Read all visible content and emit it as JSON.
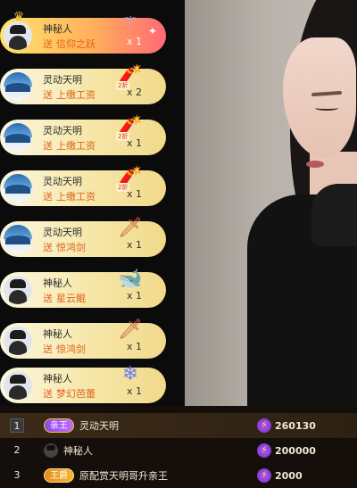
{
  "gift_feed": [
    {
      "user": "神秘人",
      "verb": "送",
      "gift": "信仰之跃",
      "count": "x 1",
      "avatar": "mystery",
      "icon": "staff-icon",
      "crown": true,
      "special": true
    },
    {
      "user": "灵动天明",
      "verb": "送",
      "gift": "上缴工资",
      "count": "x 2",
      "avatar": "landscape",
      "icon": "firecracker-icon",
      "discount": "2折"
    },
    {
      "user": "灵动天明",
      "verb": "送",
      "gift": "上缴工资",
      "count": "x 1",
      "avatar": "landscape",
      "icon": "firecracker-icon",
      "discount": "2折"
    },
    {
      "user": "灵动天明",
      "verb": "送",
      "gift": "上缴工资",
      "count": "x 1",
      "avatar": "landscape",
      "icon": "firecracker-icon",
      "discount": "2折"
    },
    {
      "user": "灵动天明",
      "verb": "送",
      "gift": "惊鸿剑",
      "count": "x 1",
      "avatar": "landscape",
      "icon": "sword-icon"
    },
    {
      "user": "神秘人",
      "verb": "送",
      "gift": "星云鲲",
      "count": "x 1",
      "avatar": "mystery",
      "icon": "fish-icon"
    },
    {
      "user": "神秘人",
      "verb": "送",
      "gift": "惊鸿剑",
      "count": "x 1",
      "avatar": "mystery",
      "icon": "sword-icon"
    },
    {
      "user": "神秘人",
      "verb": "送",
      "gift": "梦幻芭蕾",
      "count": "x 1",
      "avatar": "mystery",
      "icon": "ballet-icon"
    }
  ],
  "leaderboard": [
    {
      "rank": "1",
      "badge": "亲王",
      "name": "灵动天明",
      "score": "260130"
    },
    {
      "rank": "2",
      "badge": "",
      "name": "神秘人",
      "score": "200000"
    },
    {
      "rank": "3",
      "badge": "王爵",
      "name": "原配赏天明哥升亲王",
      "score": "2000"
    }
  ],
  "colors": {
    "gift_text": "#e0641c",
    "row_gold": "#f6e7a8",
    "special_start": "#ffe56a",
    "special_end": "#ff6a75",
    "board_bg": "#140f0a"
  }
}
